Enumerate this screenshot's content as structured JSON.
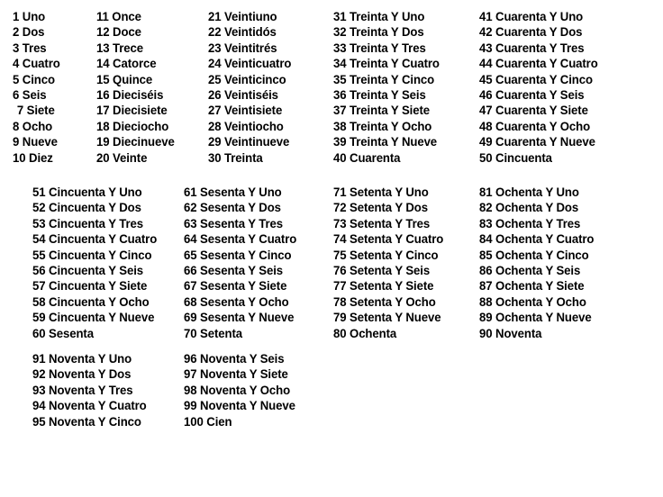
{
  "document": {
    "language": "Spanish",
    "subject": "Numbers 1 to 100 in Spanish",
    "text_color": "#000000",
    "background_color": "#ffffff"
  },
  "blocks": [
    {
      "id": "block-1",
      "columns": [
        {
          "id": "b1-c1",
          "entries": [
            {
              "num": "1",
              "word": "Uno",
              "text": "1 Uno",
              "indent": false
            },
            {
              "num": "2",
              "word": "Dos",
              "text": "2 Dos",
              "indent": false
            },
            {
              "num": "3",
              "word": "Tres",
              "text": "3 Tres",
              "indent": false
            },
            {
              "num": "4",
              "word": "Cuatro",
              "text": "4 Cuatro",
              "indent": false
            },
            {
              "num": "5",
              "word": "Cinco",
              "text": "5 Cinco",
              "indent": false
            },
            {
              "num": "6",
              "word": "Seis",
              "text": "6 Seis",
              "indent": false
            },
            {
              "num": "7",
              "word": "Siete",
              "text": "7 Siete",
              "indent": true
            },
            {
              "num": "8",
              "word": "Ocho",
              "text": "8 Ocho",
              "indent": false
            },
            {
              "num": "9",
              "word": "Nueve",
              "text": "9 Nueve",
              "indent": false
            },
            {
              "num": "10",
              "word": "Diez",
              "text": "10 Diez",
              "indent": false
            }
          ]
        },
        {
          "id": "b1-c2",
          "entries": [
            {
              "num": "11",
              "word": "Once",
              "text": "11 Once",
              "indent": false
            },
            {
              "num": "12",
              "word": "Doce",
              "text": "12 Doce",
              "indent": false
            },
            {
              "num": "13",
              "word": "Trece",
              "text": "13 Trece",
              "indent": false
            },
            {
              "num": "14",
              "word": "Catorce",
              "text": "14 Catorce",
              "indent": false
            },
            {
              "num": "15",
              "word": "Quince",
              "text": "15 Quince",
              "indent": false
            },
            {
              "num": "16",
              "word": "Dieciséis",
              "text": "16 Dieciséis",
              "indent": false
            },
            {
              "num": "17",
              "word": "Diecisiete",
              "text": "17 Diecisiete",
              "indent": false
            },
            {
              "num": "18",
              "word": "Dieciocho",
              "text": "18 Dieciocho",
              "indent": false
            },
            {
              "num": "19",
              "word": "Diecinueve",
              "text": "19 Diecinueve",
              "indent": false
            },
            {
              "num": "20",
              "word": "Veinte",
              "text": "20 Veinte",
              "indent": false
            }
          ]
        },
        {
          "id": "b1-c3",
          "entries": [
            {
              "num": "21",
              "word": "Veintiuno",
              "text": "21 Veintiuno",
              "indent": false
            },
            {
              "num": "22",
              "word": "Veintidós",
              "text": "22 Veintidós",
              "indent": false
            },
            {
              "num": "23",
              "word": "Veintitrés",
              "text": "23 Veintitrés",
              "indent": false
            },
            {
              "num": "24",
              "word": "Veinticuatro",
              "text": "24 Veinticuatro",
              "indent": false
            },
            {
              "num": "25",
              "word": "Veinticinco",
              "text": "25 Veinticinco",
              "indent": false
            },
            {
              "num": "26",
              "word": "Veintiséis",
              "text": "26 Veintiséis",
              "indent": false
            },
            {
              "num": "27",
              "word": "Veintisiete",
              "text": "27 Veintisiete",
              "indent": false
            },
            {
              "num": "28",
              "word": "Veintiocho",
              "text": "28 Veintiocho",
              "indent": false
            },
            {
              "num": "29",
              "word": "Veintinueve",
              "text": "29 Veintinueve",
              "indent": false
            },
            {
              "num": "30",
              "word": "Treinta",
              "text": "30 Treinta",
              "indent": false
            }
          ]
        },
        {
          "id": "b1-c4",
          "entries": [
            {
              "num": "31",
              "word": "Treinta Y Uno",
              "text": "31 Treinta Y Uno",
              "indent": false
            },
            {
              "num": "32",
              "word": "Treinta Y Dos",
              "text": "32 Treinta Y Dos",
              "indent": false
            },
            {
              "num": "33",
              "word": "Treinta Y Tres",
              "text": "33 Treinta Y Tres",
              "indent": false
            },
            {
              "num": "34",
              "word": "Treinta Y Cuatro",
              "text": "34 Treinta Y Cuatro",
              "indent": false
            },
            {
              "num": "35",
              "word": "Treinta Y Cinco",
              "text": "35 Treinta Y Cinco",
              "indent": false
            },
            {
              "num": "36",
              "word": "Treinta Y Seis",
              "text": "36 Treinta Y Seis",
              "indent": false
            },
            {
              "num": "37",
              "word": "Treinta Y Siete",
              "text": "37 Treinta Y Siete",
              "indent": false
            },
            {
              "num": "38",
              "word": "Treinta Y Ocho",
              "text": "38 Treinta Y Ocho",
              "indent": false
            },
            {
              "num": "39",
              "word": "Treinta Y Nueve",
              "text": "39 Treinta Y Nueve",
              "indent": false
            },
            {
              "num": "40",
              "word": "Cuarenta",
              "text": "40 Cuarenta",
              "indent": false
            }
          ]
        },
        {
          "id": "b1-c5",
          "entries": [
            {
              "num": "41",
              "word": "Cuarenta Y Uno",
              "text": "41 Cuarenta Y Uno",
              "indent": false
            },
            {
              "num": "42",
              "word": "Cuarenta Y Dos",
              "text": "42 Cuarenta Y Dos",
              "indent": false
            },
            {
              "num": "43",
              "word": "Cuarenta Y Tres",
              "text": "43 Cuarenta Y Tres",
              "indent": false
            },
            {
              "num": "44",
              "word": "Cuarenta Y Cuatro",
              "text": "44 Cuarenta Y Cuatro",
              "indent": false
            },
            {
              "num": "45",
              "word": "Cuarenta Y Cinco",
              "text": "45 Cuarenta Y Cinco",
              "indent": false
            },
            {
              "num": "46",
              "word": "Cuarenta Y Seis",
              "text": "46 Cuarenta Y Seis",
              "indent": false
            },
            {
              "num": "47",
              "word": "Cuarenta Y Siete",
              "text": "47 Cuarenta Y Siete",
              "indent": false
            },
            {
              "num": "48",
              "word": "Cuarenta Y Ocho",
              "text": "48 Cuarenta Y Ocho",
              "indent": false
            },
            {
              "num": "49",
              "word": "Cuarenta Y Nueve",
              "text": "49 Cuarenta Y Nueve",
              "indent": false
            },
            {
              "num": "50",
              "word": "Cincuenta",
              "text": "50 Cincuenta",
              "indent": false
            }
          ]
        }
      ]
    },
    {
      "id": "block-2",
      "columns": [
        {
          "id": "b2-c1",
          "entries": [
            {
              "num": "51",
              "word": "Cincuenta Y Uno",
              "text": "51 Cincuenta Y Uno",
              "indent": false
            },
            {
              "num": "52",
              "word": "Cincuenta Y Dos",
              "text": "52 Cincuenta Y Dos",
              "indent": false
            },
            {
              "num": "53",
              "word": "Cincuenta Y Tres",
              "text": "53 Cincuenta Y Tres",
              "indent": false
            },
            {
              "num": "54",
              "word": "Cincuenta Y Cuatro",
              "text": "54 Cincuenta Y Cuatro",
              "indent": false
            },
            {
              "num": "55",
              "word": "Cincuenta Y Cinco",
              "text": "55 Cincuenta Y Cinco",
              "indent": false
            },
            {
              "num": "56",
              "word": "Cincuenta Y Seis",
              "text": "56 Cincuenta Y Seis",
              "indent": false
            },
            {
              "num": "57",
              "word": "Cincuenta Y Siete",
              "text": "57 Cincuenta Y Siete",
              "indent": false
            },
            {
              "num": "58",
              "word": "Cincuenta Y Ocho",
              "text": "58 Cincuenta Y Ocho",
              "indent": false
            },
            {
              "num": "59",
              "word": "Cincuenta Y Nueve",
              "text": "59 Cincuenta Y Nueve",
              "indent": false
            },
            {
              "num": "60",
              "word": "Sesenta",
              "text": "60 Sesenta",
              "indent": false
            }
          ]
        },
        {
          "id": "b2-c2",
          "entries": [
            {
              "num": "61",
              "word": "Sesenta Y Uno",
              "text": "61 Sesenta Y Uno",
              "indent": false
            },
            {
              "num": "62",
              "word": "Sesenta Y Dos",
              "text": "62 Sesenta Y Dos",
              "indent": false
            },
            {
              "num": "63",
              "word": "Sesenta Y Tres",
              "text": "63 Sesenta Y Tres",
              "indent": false
            },
            {
              "num": "64",
              "word": "Sesenta Y Cuatro",
              "text": "64 Sesenta Y Cuatro",
              "indent": false
            },
            {
              "num": "65",
              "word": "Sesenta Y Cinco",
              "text": "65 Sesenta Y Cinco",
              "indent": false
            },
            {
              "num": "66",
              "word": "Sesenta Y Seis",
              "text": "66 Sesenta Y Seis",
              "indent": false
            },
            {
              "num": "67",
              "word": "Sesenta Y Siete",
              "text": "67 Sesenta Y Siete",
              "indent": false
            },
            {
              "num": "68",
              "word": "Sesenta Y Ocho",
              "text": "68 Sesenta Y Ocho",
              "indent": false
            },
            {
              "num": "69",
              "word": "Sesenta Y Nueve",
              "text": "69 Sesenta Y Nueve",
              "indent": false
            },
            {
              "num": "70",
              "word": "Setenta",
              "text": "70 Setenta",
              "indent": false
            }
          ]
        },
        {
          "id": "b2-c3",
          "entries": [
            {
              "num": "71",
              "word": "Setenta Y Uno",
              "text": "71 Setenta Y Uno",
              "indent": false
            },
            {
              "num": "72",
              "word": "Setenta Y Dos",
              "text": "72 Setenta Y Dos",
              "indent": false
            },
            {
              "num": "73",
              "word": "Setenta Y Tres",
              "text": "73 Setenta Y Tres",
              "indent": false
            },
            {
              "num": "74",
              "word": "Setenta Y Cuatro",
              "text": "74 Setenta Y Cuatro",
              "indent": false
            },
            {
              "num": "75",
              "word": "Setenta Y Cinco",
              "text": "75 Setenta Y Cinco",
              "indent": false
            },
            {
              "num": "76",
              "word": "Setenta Y Seis",
              "text": "76 Setenta Y Seis",
              "indent": false
            },
            {
              "num": "77",
              "word": "Setenta Y Siete",
              "text": "77 Setenta Y Siete",
              "indent": false
            },
            {
              "num": "78",
              "word": "Setenta Y Ocho",
              "text": "78 Setenta Y Ocho",
              "indent": false
            },
            {
              "num": "79",
              "word": "Setenta Y Nueve",
              "text": "79 Setenta Y Nueve",
              "indent": false
            },
            {
              "num": "80",
              "word": "Ochenta",
              "text": "80 Ochenta",
              "indent": false
            }
          ]
        },
        {
          "id": "b2-c4",
          "entries": [
            {
              "num": "81",
              "word": "Ochenta Y Uno",
              "text": "81 Ochenta Y Uno",
              "indent": false
            },
            {
              "num": "82",
              "word": "Ochenta Y Dos",
              "text": "82 Ochenta Y Dos",
              "indent": false
            },
            {
              "num": "83",
              "word": "Ochenta Y Tres",
              "text": "83 Ochenta Y Tres",
              "indent": false
            },
            {
              "num": "84",
              "word": "Ochenta Y Cuatro",
              "text": "84 Ochenta Y Cuatro",
              "indent": false
            },
            {
              "num": "85",
              "word": "Ochenta Y Cinco",
              "text": "85 Ochenta Y Cinco",
              "indent": false
            },
            {
              "num": "86",
              "word": "Ochenta Y Seis",
              "text": "86 Ochenta Y Seis",
              "indent": false
            },
            {
              "num": "87",
              "word": "Ochenta Y Siete",
              "text": "87 Ochenta Y Siete",
              "indent": false
            },
            {
              "num": "88",
              "word": "Ochenta Y Ocho",
              "text": "88 Ochenta Y Ocho",
              "indent": false
            },
            {
              "num": "89",
              "word": "Ochenta Y Nueve",
              "text": "89 Ochenta Y Nueve",
              "indent": false
            },
            {
              "num": "90",
              "word": "Noventa",
              "text": "90 Noventa",
              "indent": false
            }
          ]
        }
      ]
    },
    {
      "id": "block-3",
      "columns": [
        {
          "id": "b3-c1",
          "entries": [
            {
              "num": "91",
              "word": "Noventa Y Uno",
              "text": "91 Noventa Y Uno",
              "indent": false
            },
            {
              "num": "92",
              "word": "Noventa Y Dos",
              "text": "92 Noventa Y Dos",
              "indent": false
            },
            {
              "num": "93",
              "word": "Noventa Y Tres",
              "text": "93 Noventa Y Tres",
              "indent": false
            },
            {
              "num": "94",
              "word": "Noventa Y Cuatro",
              "text": "94 Noventa Y Cuatro",
              "indent": false
            },
            {
              "num": "95",
              "word": "Noventa Y Cinco",
              "text": "95 Noventa Y Cinco",
              "indent": false
            }
          ]
        },
        {
          "id": "b3-c2",
          "entries": [
            {
              "num": "96",
              "word": "Noventa Y Seis",
              "text": "96 Noventa Y Seis",
              "indent": false
            },
            {
              "num": "97",
              "word": "Noventa Y Siete",
              "text": "97 Noventa Y Siete",
              "indent": false
            },
            {
              "num": "98",
              "word": "Noventa Y Ocho",
              "text": "98 Noventa Y Ocho",
              "indent": false
            },
            {
              "num": "99",
              "word": "Noventa Y Nueve",
              "text": "99 Noventa Y Nueve",
              "indent": false
            },
            {
              "num": "100",
              "word": "Cien",
              "text": "100 Cien",
              "indent": false
            }
          ]
        }
      ]
    }
  ]
}
